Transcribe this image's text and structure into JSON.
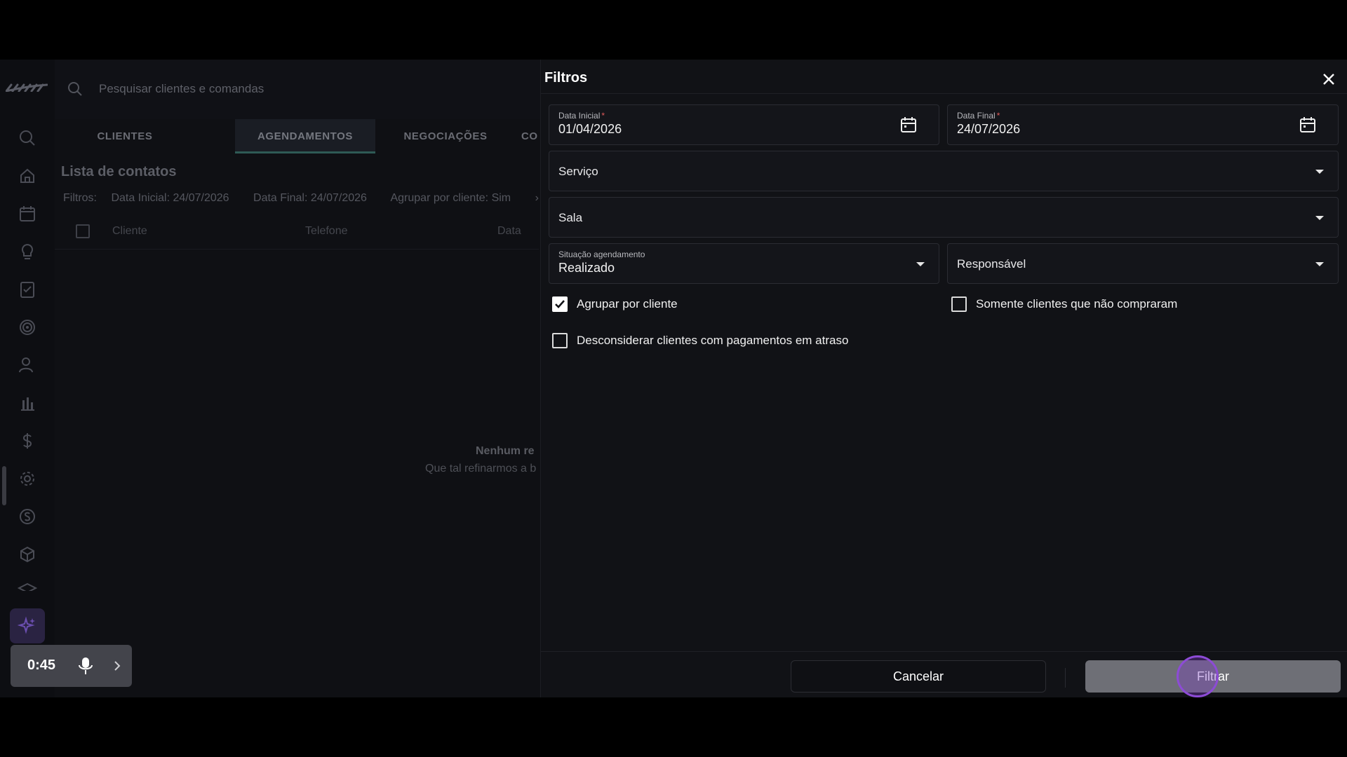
{
  "topbar": {
    "search_placeholder": "Pesquisar clientes e comandas"
  },
  "tabs": [
    {
      "label": "CLIENTES",
      "active": false
    },
    {
      "label": "AGENDAMENTOS",
      "active": true
    },
    {
      "label": "NEGOCIAÇÕES",
      "active": false
    },
    {
      "label": "CO",
      "active": false
    }
  ],
  "list": {
    "title": "Lista de contatos",
    "filters_label": "Filtros:",
    "filter_chips": [
      "Data Inicial: 24/07/2026",
      "Data Final: 24/07/2026",
      "Agrupar por cliente: Sim"
    ],
    "columns": [
      "Cliente",
      "Telefone",
      "Data"
    ],
    "empty_title": "Nenhum re",
    "empty_subtitle": "Que tal refinarmos a b"
  },
  "timer": {
    "time": "0:45"
  },
  "drawer": {
    "title": "Filtros",
    "start_date": {
      "label": "Data Inicial",
      "required_mark": "*",
      "value": "01/04/2026"
    },
    "end_date": {
      "label": "Data Final",
      "required_mark": "*",
      "value": "24/07/2026"
    },
    "service": {
      "placeholder": "Serviço"
    },
    "room": {
      "placeholder": "Sala"
    },
    "status": {
      "label": "Situação agendamento",
      "value": "Realizado"
    },
    "responsible": {
      "placeholder": "Responsável"
    },
    "checkboxes": {
      "group_by_client": {
        "label": "Agrupar por cliente",
        "checked": true
      },
      "only_non_buyers": {
        "label": "Somente clientes que não compraram",
        "checked": false
      },
      "ignore_late_payments": {
        "label": "Desconsiderar clientes com pagamentos em atraso",
        "checked": false
      }
    },
    "cancel_label": "Cancelar",
    "filter_label": "Filtrar"
  },
  "colors": {
    "accent_purple": "#8d4bd6",
    "required": "#e05a5a",
    "tab_underline": "#2e5a55"
  }
}
